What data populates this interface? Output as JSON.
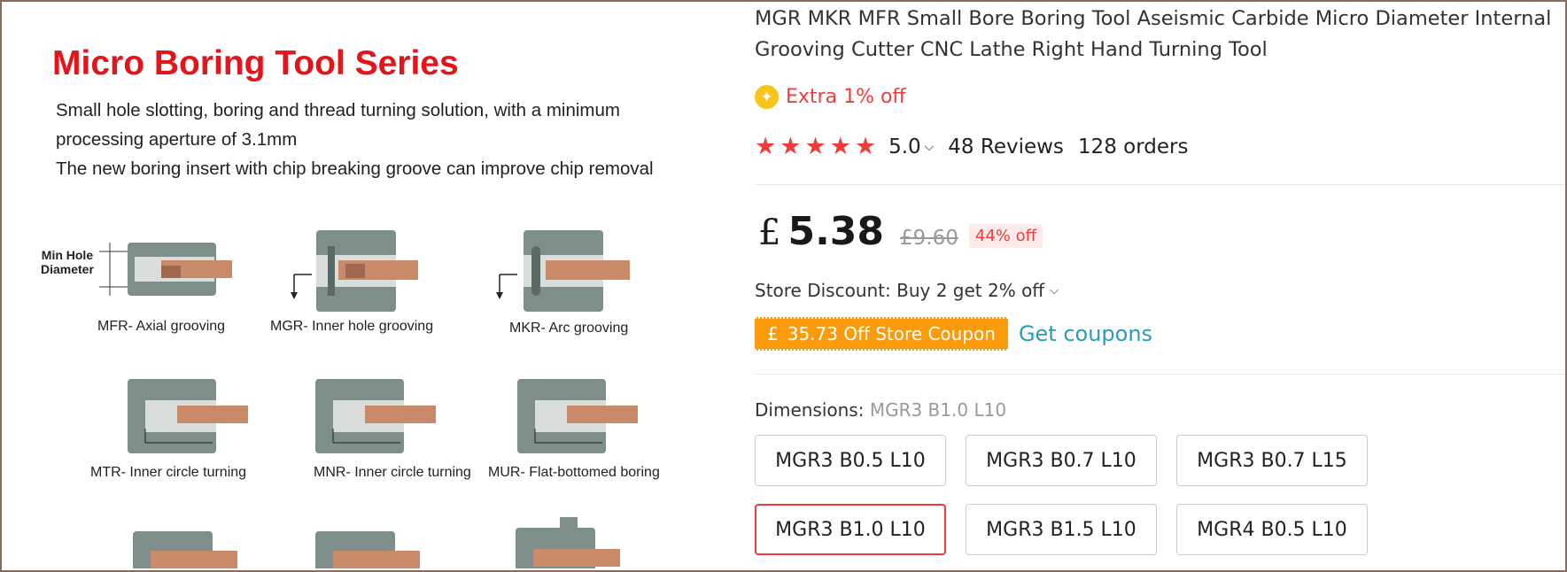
{
  "promo": {
    "title": "Micro Boring Tool Series",
    "desc_line1": "Small hole slotting, boring and thread turning solution, with a minimum processing aperture of 3.1mm",
    "desc_line2": "The new boring insert with chip breaking groove can improve chip removal",
    "min_hole_label": "Min Hole\nDiameter",
    "diagrams": [
      {
        "label": "MFR- Axial grooving"
      },
      {
        "label": "MGR- Inner hole grooving"
      },
      {
        "label": "MKR- Arc grooving"
      },
      {
        "label": "MTR- Inner circle turning"
      },
      {
        "label": "MNR- Inner circle turning"
      },
      {
        "label": "MUR- Flat-bottomed boring"
      }
    ]
  },
  "product": {
    "title": "MGR MKR MFR Small Bore Boring Tool Aseismic Carbide Micro Diameter Internal Grooving Cutter CNC Lathe Right Hand Turning Tool",
    "extra_off": "Extra 1% off",
    "rating_value": "5.0",
    "reviews": "48 Reviews",
    "orders": "128 orders",
    "currency": "£",
    "price": "5.38",
    "old_price": "£9.60",
    "discount_badge": "44% off",
    "store_discount": "Store Discount: Buy 2 get 2% off",
    "coupon_currency": "£",
    "coupon_text": "35.73 Off Store Coupon",
    "get_coupons": "Get coupons",
    "dimensions_label": "Dimensions:",
    "dimensions_selected": "MGR3 B1.0 L10",
    "options": [
      {
        "label": "MGR3 B0.5 L10",
        "selected": false
      },
      {
        "label": "MGR3 B0.7 L10",
        "selected": false
      },
      {
        "label": "MGR3 B0.7 L15",
        "selected": false
      },
      {
        "label": "MGR3 B1.0 L10",
        "selected": true
      },
      {
        "label": "MGR3 B1.5 L10",
        "selected": false
      },
      {
        "label": "MGR4 B0.5 L10",
        "selected": false
      }
    ]
  },
  "colors": {
    "accent_red": "#f03c3c",
    "coupon_orange": "#fb9a0a",
    "link_blue": "#2b9bbd",
    "promo_red": "#e4141b"
  }
}
